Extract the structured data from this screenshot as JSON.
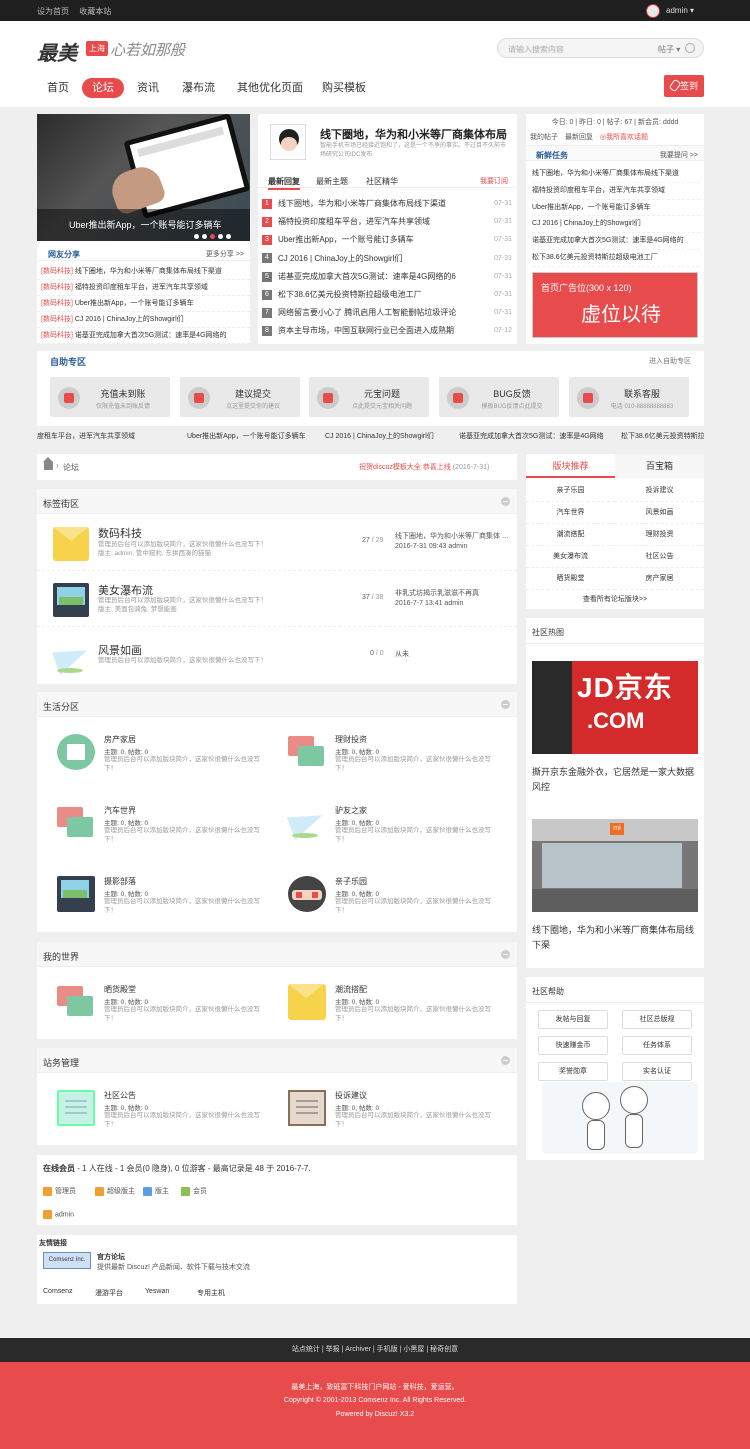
{
  "topbar": {
    "links": [
      "设为首页",
      "收藏本站"
    ],
    "user": "admin ▾"
  },
  "header": {
    "logo": "最美",
    "logo_badge": "上海",
    "slogan": "心若如那般",
    "search_placeholder": "请输入搜索内容",
    "search_scope": "帖子 ▾",
    "signin": "签到"
  },
  "nav": [
    "首页",
    "论坛",
    "资讯",
    "瀑布流",
    "其他优化页面",
    "购买模板"
  ],
  "slider": {
    "caption": "Uber推出新App，一个账号能订多辆车",
    "share_title": "网友分享",
    "share_more": "更多分享 >>",
    "items": [
      {
        "tag": "[数码科技]",
        "text": " 线下圈地，华为和小米等厂商集体布局线下渠道"
      },
      {
        "tag": "[数码科技]",
        "text": " 福特投资印度租车平台，进军汽车共享领域"
      },
      {
        "tag": "[数码科技]",
        "text": " Uber推出新App，一个账号能订多辆车"
      },
      {
        "tag": "[数码科技]",
        "text": " CJ 2016 | ChinaJoy上的Showgirl们"
      },
      {
        "tag": "[数码科技]",
        "text": " 诺基亚完成加拿大首次5G测试：速率是4G网络的"
      }
    ]
  },
  "center": {
    "title": "线下圈地，华为和小米等厂商集体布局",
    "desc": "智能手机市场已经接近饱和了，这是一个不争的事实。不过目不久前市场研究公司IDC发布",
    "tabs": [
      "最新回复",
      "最新主题",
      "社区精华"
    ],
    "more": "我要订阅",
    "items": [
      {
        "n": "1",
        "t": "线下圈地，华为和小米等厂商集体布局线下渠道",
        "d": "07-31"
      },
      {
        "n": "2",
        "t": "福特投资印度租车平台，进军汽车共享领域",
        "d": "07-31"
      },
      {
        "n": "3",
        "t": "Uber推出新App，一个账号能订多辆车",
        "d": "07-31"
      },
      {
        "n": "4",
        "t": "CJ 2016 | ChinaJoy上的Showgirl们",
        "d": "07-31"
      },
      {
        "n": "5",
        "t": "诺基亚完成加拿大首次5G测试：速率是4G网络的6",
        "d": "07-31"
      },
      {
        "n": "6",
        "t": "松下38.6亿美元投资特斯拉超级电池工厂",
        "d": "07-31"
      },
      {
        "n": "7",
        "t": "网络留言要小心了 腾讯启用人工智能删帖垃圾评论",
        "d": "07-31"
      },
      {
        "n": "8",
        "t": "资本主导市场，中国互联网行业已全面进入成熟期",
        "d": "07-12"
      }
    ]
  },
  "rtop": {
    "stats": "今日: 0 | 昨日: 0 | 帖子: 67 | 新会员: dddd",
    "tabs": [
      "我的帖子",
      "最新回复",
      "◎我所喜欢话题"
    ],
    "task_title": "新鲜任务",
    "task_more": "我要提问 >>",
    "items": [
      "线下圈地，华为和小米等厂商集体布局线下渠道",
      "福特投资印度租车平台，进军汽车共享领域",
      "Uber推出新App，一个账号能订多辆车",
      "CJ 2016 | ChinaJoy上的Showgirl们",
      "诺基亚完成加拿大首次5G测试：速率是4G网络的",
      "松下38.6亿美元投资特斯拉超级电池工厂"
    ],
    "ad_small": "首页广告位(300 x 120)",
    "ad_big": "虚位以待"
  },
  "selfhelp": {
    "title": "自助专区",
    "more": "进入自助专区",
    "boxes": [
      {
        "t": "充值未到账",
        "s": "仅限充值未到账反馈"
      },
      {
        "t": "建议提交",
        "s": "点这里提交你的建议"
      },
      {
        "t": "元宝问题",
        "s": "点此提交元宝相关问题"
      },
      {
        "t": "BUG反馈",
        "s": "模板BUG反馈点此提交"
      },
      {
        "t": "联系客服",
        "s": "电话 010-88888888883"
      }
    ]
  },
  "ticker": [
    "度租车平台，进军汽车共享领域",
    "Uber推出新App，一个账号能订多辆车",
    "CJ 2016 | ChinaJoy上的Showgirl们",
    "诺基亚完成加拿大首次5G测试：速率是4G网络",
    "松下38.6亿美元投资特斯拉超级电"
  ],
  "crumb": {
    "title": "论坛",
    "notice": "祝贺discuz模板大全 恭喜上线  ",
    "notice_date": "(2016-7-31)"
  },
  "blocks": {
    "b1": {
      "title": "标签街区",
      "forums": [
        {
          "name": "数码科技",
          "desc": "管理员后台可以添加版块简介，这家伙很懒什么也没写下！",
          "mod": "版主: admin, 管中窥豹, 东拼西凑的猫猫",
          "count": "27",
          "total": " / 29",
          "last1": "线下圈地，华为和小米等厂商集体 …",
          "last2": "2016-7-31 09:43 admin"
        },
        {
          "name": "美女瀑布流",
          "desc": "管理员后台可以添加版块简介，这家伙很懒什么也没写下！",
          "mod": "版主: 美面包骑兔, 梦想能画",
          "count": "37",
          "total": " / 38",
          "last1": "非乳式坊揭示乳滋滋不再真",
          "last2": "2016-7-7 13:41 admin"
        },
        {
          "name": "风景如画",
          "desc": "管理员后台可以添加版块简介，这家伙很懒什么也没写下！",
          "mod": "",
          "count": "0",
          "total": " / 0",
          "last1": "从未",
          "last2": ""
        }
      ]
    },
    "b2": {
      "title": "生活分区",
      "cells": [
        {
          "t": "房产家居",
          "s": "主题: 0, 帖数: 0",
          "d": "管理员后台可以添加版块简介，这家伙很懒什么也没写下！"
        },
        {
          "t": "理财投资",
          "s": "主题: 0, 帖数: 0",
          "d": "管理员后台可以添加版块简介，这家伙很懒什么也没写下！"
        },
        {
          "t": "汽车世界",
          "s": "主题: 0, 帖数: 0",
          "d": "管理员后台可以添加版块简介，这家伙很懒什么也没写下！"
        },
        {
          "t": "驴友之家",
          "s": "主题: 0, 帖数: 0",
          "d": "管理员后台可以添加版块简介，这家伙很懒什么也没写下！"
        },
        {
          "t": "摄影部落",
          "s": "主题: 0, 帖数: 0",
          "d": "管理员后台可以添加版块简介，这家伙很懒什么也没写下！"
        },
        {
          "t": "亲子乐园",
          "s": "主题: 0, 帖数: 0",
          "d": "管理员后台可以添加版块简介，这家伙很懒什么也没写下！"
        }
      ]
    },
    "b3": {
      "title": "我的世界",
      "cells": [
        {
          "t": "晒货殿堂",
          "s": "主题: 0, 帖数: 0",
          "d": "管理员后台可以添加版块简介，这家伙很懒什么也没写下！"
        },
        {
          "t": "潮流搭配",
          "s": "主题: 0, 帖数: 0",
          "d": "管理员后台可以添加版块简介，这家伙很懒什么也没写下！"
        }
      ]
    },
    "b4": {
      "title": "站务管理",
      "cells": [
        {
          "t": "社区公告",
          "s": "主题: 0, 帖数: 0",
          "d": "管理员后台可以添加版块简介，这家伙很懒什么也没写下！"
        },
        {
          "t": "投诉建议",
          "s": "主题: 0, 帖数: 0",
          "d": "管理员后台可以添加版块简介，这家伙很懒什么也没写下！"
        }
      ]
    }
  },
  "online": {
    "label": "在线会员",
    "text": " - 1 人在线 - 1 会员(0 隐身), 0 位游客 - 最高记录是 48 于 2016-7-7.",
    "legend": [
      "管理员",
      "超级版主",
      "版主",
      "会员"
    ],
    "legend_colors": [
      "#f0a030",
      "#f0a030",
      "#5aa0e0",
      "#90c050"
    ],
    "user": "admin"
  },
  "friends": {
    "title": "友情链接",
    "logo_text": "Comsenz Inc.",
    "name": "官方论坛",
    "desc": "提供最新 Discuz! 产品新闻、软件下载与技术交流",
    "links": [
      "Comsenz",
      "漫游平台",
      "Yeswan",
      "专用主机"
    ]
  },
  "right": {
    "tabs": [
      "版块推荐",
      "百宝箱"
    ],
    "grid": [
      "亲子乐园",
      "投诉建议",
      "汽车世界",
      "风景如画",
      "潮流搭配",
      "理财投资",
      "美女瀑布流",
      "社区公告",
      "晒货殿堂",
      "房产家居"
    ],
    "all": "查看所有论坛版块>>",
    "hot_title": "社区热图",
    "img1_text": "JD京东",
    "img1_text2": ".COM",
    "img2_text": "mi",
    "cap1": "撕开京东金融外衣，它居然是一家大数据风控",
    "cap2": "线下圈地，华为和小米等厂商集体布局线下渠",
    "help_title": "社区帮助",
    "help_btns": [
      "发帖与回复",
      "社区总版规",
      "快速赚金币",
      "任务体系",
      "奖誉勋章",
      "实名认证"
    ]
  },
  "footer": {
    "nav": "站点统计 | 举报 | Archiver | 手机版 | 小黑屋 | 秘奇创意",
    "line1": "最美上海，致砥富下科技门户网站 - 爱科技，爱运营。",
    "line2": "Copyright © 2001-2013 Comsenz Inc.   All Rights Reserved.",
    "line3": "Powered by Discuz! X3.2"
  },
  "colors": {
    "accent": "#e84b4b",
    "link_blue": "#2a5c9a",
    "dark": "#1f1f1f"
  }
}
